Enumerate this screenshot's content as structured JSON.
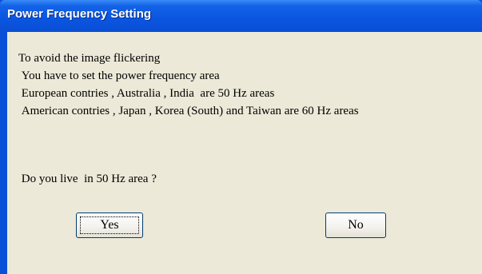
{
  "window": {
    "title": "Power Frequency Setting"
  },
  "message": {
    "lines": [
      "To avoid the image flickering",
      " You have to set the power frequency area",
      " European contries , Australia , India  are 50 Hz areas",
      " American contries , Japan , Korea (South) and Taiwan are 60 Hz areas"
    ],
    "question": " Do you live  in 50 Hz area ?"
  },
  "buttons": {
    "yes_label": "Yes",
    "no_label": "No"
  },
  "colors": {
    "title_bar": "#0a55e0",
    "dialog_background": "#ece9d8",
    "button_border": "#003c74"
  }
}
